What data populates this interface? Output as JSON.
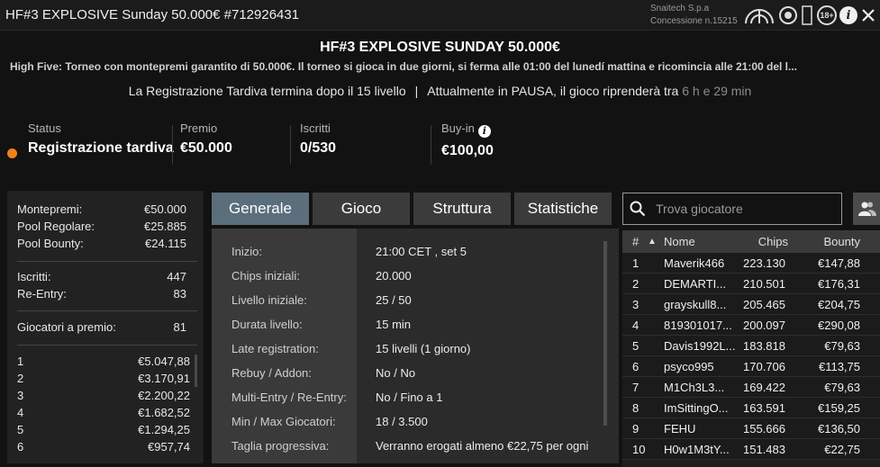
{
  "window": {
    "title": "HF#3 EXPLOSIVE Sunday 50.000€ #712926431",
    "company": "Snaitech S.p.a",
    "concession": "Concessione n.15215",
    "badge_18": "18+",
    "info_glyph": "i"
  },
  "header": {
    "title": "HF#3 EXPLOSIVE SUNDAY 50.000€",
    "description": "High Five: Torneo con montepremi garantito di 50.000€. Il torneo si gioca in due giorni, si ferma alle 01:00 del lunedí mattina e ricomincia alle 21:00 del l...",
    "late_reg": "La Registrazione Tardiva termina dopo il 15 livello",
    "separator": "|",
    "pause_text": "Attualmente in PAUSA, il gioco riprenderà tra",
    "pause_time": "6 h e 29 min"
  },
  "stats": {
    "status": {
      "label": "Status",
      "value": "Registrazione tardiva",
      "dot_color": "#f0801a"
    },
    "prize": {
      "label": "Premio",
      "value": "€50.000"
    },
    "entries": {
      "label": "Iscritti",
      "value": "0/530"
    },
    "buyin": {
      "label": "Buy-in",
      "value": "€100,00"
    }
  },
  "prize_panel": {
    "summary": [
      {
        "label": "Montepremi:",
        "value": "€50.000"
      },
      {
        "label": "Pool Regolare:",
        "value": "€25.885"
      },
      {
        "label": "Pool Bounty:",
        "value": "€24.115"
      }
    ],
    "entries": [
      {
        "label": "Iscritti:",
        "value": "447"
      },
      {
        "label": "Re-Entry:",
        "value": "83"
      }
    ],
    "paid": {
      "label": "Giocatori a premio:",
      "value": "81"
    },
    "payouts": [
      {
        "pos": "1",
        "amount": "€5.047,88"
      },
      {
        "pos": "2",
        "amount": "€3.170,91"
      },
      {
        "pos": "3",
        "amount": "€2.200,22"
      },
      {
        "pos": "4",
        "amount": "€1.682,52"
      },
      {
        "pos": "5",
        "amount": "€1.294,25"
      },
      {
        "pos": "6",
        "amount": "€957,74"
      }
    ]
  },
  "tabs": [
    {
      "label": "Generale",
      "active": true
    },
    {
      "label": "Gioco",
      "active": false
    },
    {
      "label": "Struttura",
      "active": false
    },
    {
      "label": "Statistiche",
      "active": false
    }
  ],
  "general": [
    {
      "key": "Inizio:",
      "value": "21:00 CET , set 5"
    },
    {
      "key": "Chips iniziali:",
      "value": "20.000"
    },
    {
      "key": "Livello iniziale:",
      "value": "25 / 50"
    },
    {
      "key": "Durata livello:",
      "value": "15 min"
    },
    {
      "key": "Late registration:",
      "value": "15 livelli (1 giorno)"
    },
    {
      "key": "Rebuy / Addon:",
      "value": "No / No"
    },
    {
      "key": "Multi-Entry / Re-Entry:",
      "value": "No / Fino a 1"
    },
    {
      "key": "Min / Max Giocatori:",
      "value": "18 / 3.500"
    },
    {
      "key": "Taglia progressiva:",
      "value": "Verranno erogati almeno €22,75 per ogni"
    }
  ],
  "search": {
    "placeholder": "Trova giocatore"
  },
  "players": {
    "headers": {
      "rank": "#",
      "sort_arrow": "▲",
      "name": "Nome",
      "chips": "Chips",
      "bounty": "Bounty"
    },
    "rows": [
      {
        "rank": "1",
        "name": "Maverik466",
        "chips": "223.130",
        "bounty": "€147,88"
      },
      {
        "rank": "2",
        "name": "DEMARTI...",
        "chips": "210.501",
        "bounty": "€176,31"
      },
      {
        "rank": "3",
        "name": "grayskull8...",
        "chips": "205.465",
        "bounty": "€204,75"
      },
      {
        "rank": "4",
        "name": "819301017...",
        "chips": "200.097",
        "bounty": "€290,08"
      },
      {
        "rank": "5",
        "name": "Davis1992L...",
        "chips": "183.818",
        "bounty": "€79,63"
      },
      {
        "rank": "6",
        "name": "psyco995",
        "chips": "170.706",
        "bounty": "€113,75"
      },
      {
        "rank": "7",
        "name": "M1Ch3L3...",
        "chips": "169.422",
        "bounty": "€79,63"
      },
      {
        "rank": "8",
        "name": "ImSittingO...",
        "chips": "163.591",
        "bounty": "€159,25"
      },
      {
        "rank": "9",
        "name": "FEHU",
        "chips": "155.666",
        "bounty": "€136,50"
      },
      {
        "rank": "10",
        "name": "H0w1M3tY...",
        "chips": "151.483",
        "bounty": "€22,75"
      }
    ]
  }
}
